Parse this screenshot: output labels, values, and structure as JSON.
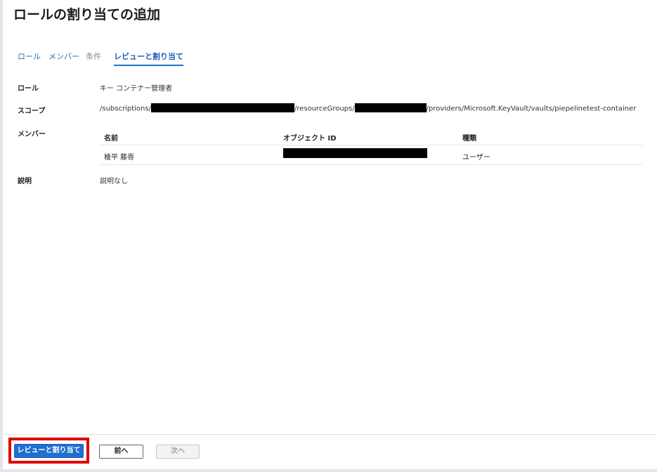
{
  "header": {
    "title": "ロールの割り当ての追加",
    "more": "···"
  },
  "tabs": [
    {
      "label": "ロール",
      "state": "normal"
    },
    {
      "label": "メンバー",
      "state": "normal"
    },
    {
      "label": "条件",
      "state": "disabled"
    },
    {
      "label": "レビューと割り当て",
      "state": "active"
    }
  ],
  "review": {
    "role_label": "ロール",
    "role_value": "キー コンテナー管理者",
    "scope_label": "スコープ",
    "scope_parts": {
      "prefix": "/subscriptions/",
      "mid": "/resourceGroups/",
      "suffix": "/providers/Microsoft.KeyVault/vaults/piepelinetest-container"
    },
    "members_label": "メンバー",
    "members_table": {
      "headers": [
        "名前",
        "オブジェクト ID",
        "種類"
      ],
      "rows": [
        {
          "name": "稜平 藤嵜",
          "type": "ユーザー"
        }
      ]
    },
    "description_label": "説明",
    "description_value": "説明なし"
  },
  "footer": {
    "review_assign": "レビューと割り当て",
    "prev": "前へ",
    "next": "次へ"
  },
  "colors": {
    "accent": "#1f6fd1",
    "highlight": "#e00000",
    "redaction": "#000000"
  }
}
